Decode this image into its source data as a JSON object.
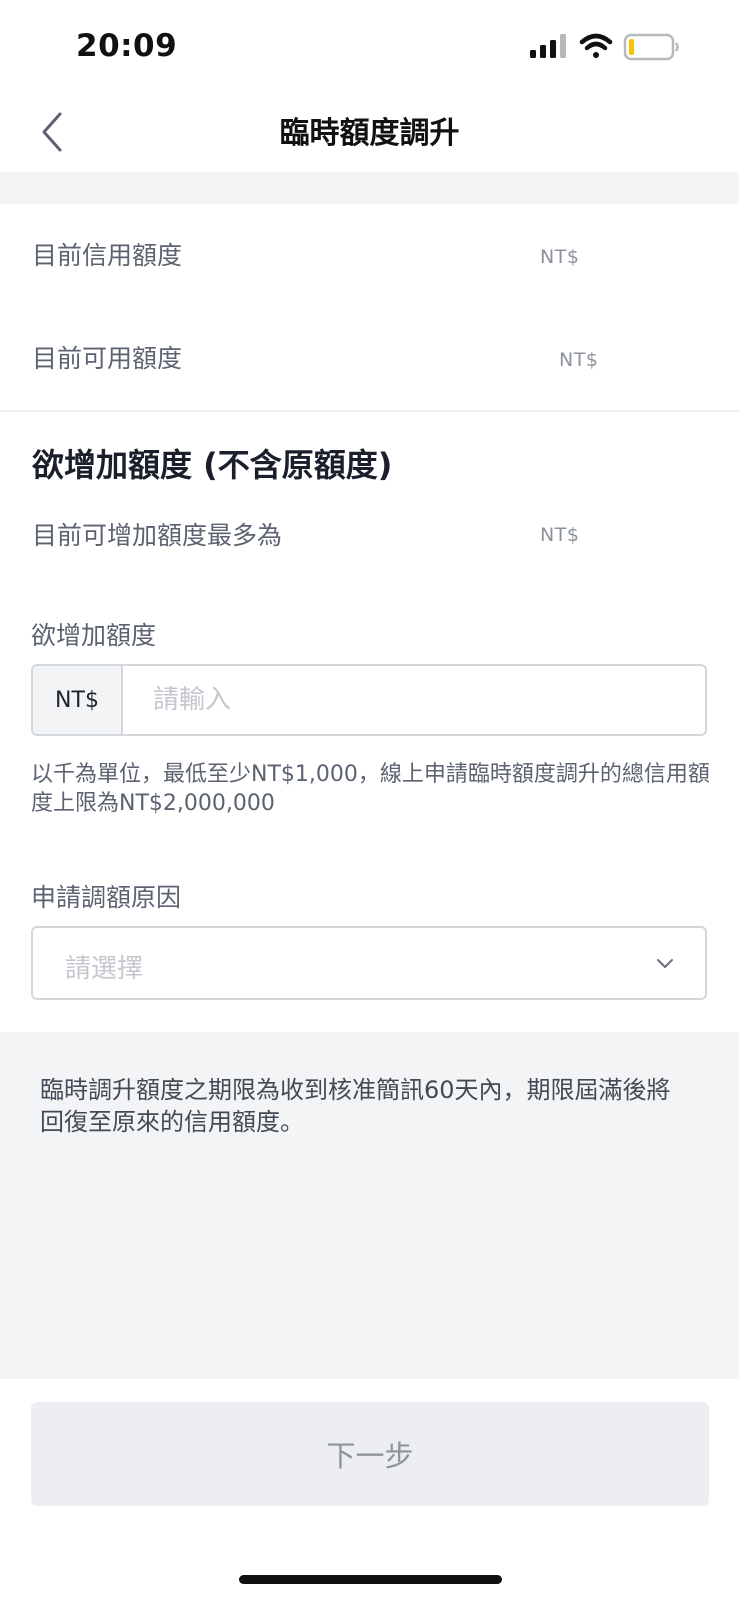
{
  "status_bar": {
    "time": "20:09",
    "signal_icon": "cellular-signal-icon",
    "wifi_icon": "wifi-icon",
    "battery_icon": "battery-low-icon",
    "battery_color": "#f5c400"
  },
  "nav": {
    "back_icon": "chevron-left-icon",
    "title": "臨時額度調升"
  },
  "credit_info": {
    "current_limit_label": "目前信用額度",
    "current_limit_value": "NT$",
    "available_label": "目前可用額度",
    "available_value": "NT$"
  },
  "increase_section": {
    "title": "欲增加額度 (不含原額度)",
    "max_label": "目前可增加額度最多為",
    "max_value": "NT$",
    "amount_label": "欲增加額度",
    "amount_prefix": "NT$",
    "amount_placeholder": "請輸入",
    "amount_value": "",
    "hint": "以千為單位，最低至少NT$1,000，線上申請臨時額度調升的總信用額度上限為NT$2,000,000"
  },
  "reason": {
    "label": "申請調額原因",
    "placeholder": "請選擇",
    "chevron_icon": "chevron-down-icon"
  },
  "notice": {
    "text": "臨時調升額度之期限為收到核准簡訊60天內，期限屆滿後將回復至原來的信用額度。"
  },
  "footer": {
    "next_label": "下一步"
  },
  "colors": {
    "page_background": "#ffffff",
    "band_gray": "#f3f4f6",
    "border_gray": "#d3d7dd",
    "disabled_button": "#eceef1",
    "disabled_button_text": "#8e949c"
  }
}
